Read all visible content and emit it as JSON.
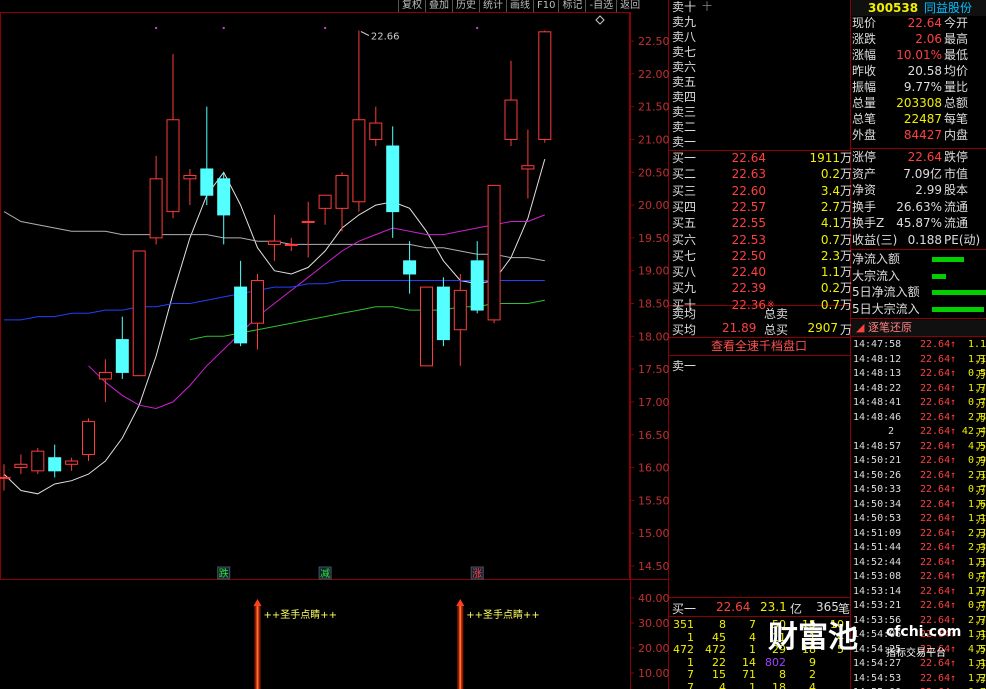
{
  "toolbar": {
    "items": [
      "复权",
      "叠加",
      "历史",
      "统计",
      "画线",
      "F10",
      "标记",
      "-自选",
      "返回"
    ]
  },
  "chart_data": {
    "type": "candlestick",
    "yaxis": {
      "ticks": [
        "22.50",
        "22.00",
        "21.50",
        "21.00",
        "20.50",
        "20.00",
        "19.50",
        "19.00",
        "18.50",
        "18.00",
        "17.50",
        "17.00",
        "16.50",
        "16.00",
        "15.50",
        "15.00",
        "14.50"
      ],
      "min": 14.5,
      "max": 22.5
    },
    "max_label": "22.66",
    "candles": [
      {
        "o": 15.85,
        "c": 15.85,
        "h": 16.05,
        "l": 15.65
      },
      {
        "o": 16.0,
        "c": 16.05,
        "h": 16.2,
        "l": 15.9
      },
      {
        "o": 15.95,
        "c": 16.25,
        "h": 16.3,
        "l": 15.9
      },
      {
        "o": 16.15,
        "c": 15.95,
        "h": 16.35,
        "l": 15.85
      },
      {
        "o": 16.05,
        "c": 16.1,
        "h": 16.15,
        "l": 15.95
      },
      {
        "o": 16.2,
        "c": 16.7,
        "h": 16.75,
        "l": 16.1
      },
      {
        "o": 17.35,
        "c": 17.45,
        "h": 17.65,
        "l": 17.0
      },
      {
        "o": 17.95,
        "c": 17.45,
        "h": 18.3,
        "l": 17.35
      },
      {
        "o": 17.4,
        "c": 19.3,
        "h": 19.3,
        "l": 17.4
      },
      {
        "o": 19.5,
        "c": 20.4,
        "h": 20.75,
        "l": 19.4
      },
      {
        "o": 19.9,
        "c": 21.3,
        "h": 22.3,
        "l": 19.8
      },
      {
        "o": 20.4,
        "c": 20.45,
        "h": 20.55,
        "l": 20.0
      },
      {
        "o": 20.55,
        "c": 20.15,
        "h": 21.5,
        "l": 20.0
      },
      {
        "o": 20.4,
        "c": 19.85,
        "h": 20.5,
        "l": 19.4
      },
      {
        "o": 18.75,
        "c": 17.9,
        "h": 19.15,
        "l": 17.85
      },
      {
        "o": 18.2,
        "c": 18.85,
        "h": 18.95,
        "l": 17.8
      },
      {
        "o": 19.4,
        "c": 19.45,
        "h": 19.85,
        "l": 19.15
      },
      {
        "o": 19.4,
        "c": 19.4,
        "h": 19.5,
        "l": 19.3
      },
      {
        "o": 19.75,
        "c": 19.75,
        "h": 20.05,
        "l": 19.2
      },
      {
        "o": 19.95,
        "c": 20.15,
        "h": 20.15,
        "l": 19.7
      },
      {
        "o": 19.95,
        "c": 20.45,
        "h": 20.5,
        "l": 19.6
      },
      {
        "o": 20.05,
        "c": 21.3,
        "h": 22.66,
        "l": 19.9
      },
      {
        "o": 21.0,
        "c": 21.25,
        "h": 21.5,
        "l": 20.9
      },
      {
        "o": 20.9,
        "c": 19.9,
        "h": 21.2,
        "l": 19.5
      },
      {
        "o": 19.15,
        "c": 18.95,
        "h": 19.45,
        "l": 18.65
      },
      {
        "o": 17.55,
        "c": 18.75,
        "h": 18.75,
        "l": 17.55
      },
      {
        "o": 18.75,
        "c": 17.95,
        "h": 18.9,
        "l": 17.85
      },
      {
        "o": 18.1,
        "c": 18.7,
        "h": 18.95,
        "l": 17.55
      },
      {
        "o": 19.15,
        "c": 18.4,
        "h": 19.45,
        "l": 18.35
      },
      {
        "o": 18.25,
        "c": 20.3,
        "h": 20.3,
        "l": 18.2
      },
      {
        "o": 21.0,
        "c": 21.6,
        "h": 22.2,
        "l": 20.9
      },
      {
        "o": 20.55,
        "c": 20.6,
        "h": 21.15,
        "l": 20.1
      },
      {
        "o": 21.0,
        "c": 22.64,
        "h": 22.66,
        "l": 20.95
      }
    ],
    "ma": {
      "white": [
        15.9,
        15.65,
        15.6,
        15.75,
        15.8,
        15.9,
        16.1,
        16.45,
        16.95,
        17.7,
        18.65,
        19.5,
        20.15,
        20.5,
        20.0,
        19.35,
        19.0,
        18.95,
        19.05,
        19.3,
        19.65,
        19.85,
        20.0,
        20.05,
        19.95,
        19.6,
        19.15,
        18.85,
        18.8,
        18.85,
        19.2,
        19.8,
        20.7
      ],
      "gray": [
        19.9,
        19.75,
        19.7,
        19.65,
        19.6,
        19.6,
        19.6,
        19.55,
        19.55,
        19.55,
        19.55,
        19.55,
        19.55,
        19.5,
        19.5,
        19.45,
        19.45,
        19.4,
        19.4,
        19.4,
        19.4,
        19.4,
        19.4,
        19.4,
        19.4,
        19.35,
        19.35,
        19.3,
        19.25,
        19.25,
        19.2,
        19.2,
        19.15
      ],
      "magenta": [
        null,
        null,
        null,
        null,
        null,
        17.55,
        17.3,
        17.1,
        16.95,
        16.9,
        17.0,
        17.25,
        17.55,
        17.8,
        18.05,
        18.3,
        18.5,
        18.7,
        18.9,
        19.1,
        19.3,
        19.45,
        19.55,
        19.65,
        19.6,
        19.55,
        19.55,
        19.6,
        19.65,
        19.7,
        19.75,
        19.75,
        19.85
      ],
      "blue": [
        18.25,
        18.25,
        18.3,
        18.3,
        18.35,
        18.35,
        18.4,
        18.4,
        18.45,
        18.45,
        18.5,
        18.5,
        18.55,
        18.6,
        18.65,
        18.7,
        18.75,
        18.75,
        18.8,
        18.8,
        18.85,
        18.85,
        18.85,
        18.85,
        18.85,
        18.85,
        18.85,
        18.85,
        18.85,
        18.85,
        18.85,
        18.85,
        18.85
      ],
      "green": [
        null,
        null,
        null,
        null,
        null,
        null,
        null,
        null,
        null,
        null,
        null,
        17.95,
        18.0,
        18.0,
        18.05,
        18.1,
        18.15,
        18.2,
        18.25,
        18.3,
        18.35,
        18.4,
        18.45,
        18.45,
        18.4,
        18.4,
        18.4,
        18.45,
        18.45,
        18.5,
        18.5,
        18.5,
        18.55
      ]
    },
    "markers": [
      {
        "i": 13,
        "text": "跌",
        "color": "#30e030"
      },
      {
        "i": 19,
        "text": "减",
        "color": "#30e030"
      },
      {
        "i": 28,
        "text": "涨",
        "color": "#ff4040"
      }
    ],
    "indicator": {
      "ticks": [
        "40.00",
        "30.00",
        "20.00",
        "10.00"
      ],
      "signals": [
        {
          "i": 15,
          "text": "++圣手点睛++"
        },
        {
          "i": 27,
          "text": "++圣手点睛++"
        }
      ]
    }
  },
  "stock": {
    "code": "300538",
    "name": "同益股份"
  },
  "info": [
    {
      "l": "现价",
      "v": "22.64",
      "vc": "#ff4040",
      "r": "今开"
    },
    {
      "l": "涨跌",
      "v": "2.06",
      "vc": "#ff4040",
      "r": "最高"
    },
    {
      "l": "涨幅",
      "v": "10.01%",
      "vc": "#ff4040",
      "r": "最低"
    },
    {
      "l": "昨收",
      "v": "20.58",
      "vc": "#dddddd",
      "r": "均价"
    },
    {
      "l": "振幅",
      "v": "9.77%",
      "vc": "#dddddd",
      "r": "量比"
    },
    {
      "l": "总量",
      "v": "203308",
      "vc": "#f0f000",
      "r": "总额"
    },
    {
      "l": "总笔",
      "v": "22487",
      "vc": "#f0f000",
      "r": "每笔"
    },
    {
      "l": "外盘",
      "v": "84427",
      "vc": "#ff4040",
      "r": "内盘"
    },
    {
      "l": "涨停",
      "v": "22.64",
      "vc": "#ff4040",
      "r": "跌停"
    },
    {
      "l": "资产",
      "v": "7.09亿",
      "vc": "#dddddd",
      "r": "市值"
    },
    {
      "l": "净资",
      "v": "2.99",
      "vc": "#dddddd",
      "r": "股本"
    },
    {
      "l": "换手",
      "v": "26.63%",
      "vc": "#dddddd",
      "r": "流通"
    },
    {
      "l": "换手Z",
      "v": "45.87%",
      "vc": "#dddddd",
      "r": "流通"
    },
    {
      "l": "收益(三)",
      "v": "0.188",
      "vc": "#dddddd",
      "r": "PE(动)"
    }
  ],
  "flows": [
    {
      "label": "净流入额",
      "w": 32
    },
    {
      "label": "大宗流入",
      "w": 14
    },
    {
      "label": "5日净流入额",
      "w": 56
    },
    {
      "label": "5日大宗流入",
      "w": 52
    }
  ],
  "ticks_title": "逐笔还原",
  "ticks": [
    {
      "t": "14:47:58",
      "p": "22.64",
      "v": "1.1万",
      "n": ""
    },
    {
      "t": "14:48:12",
      "p": "22.64",
      "v": "1.1万",
      "n": ""
    },
    {
      "t": "14:48:13",
      "p": "22.64",
      "v": "0.5万",
      "n": ""
    },
    {
      "t": "14:48:22",
      "p": "22.64",
      "v": "1.7万",
      "n": ""
    },
    {
      "t": "14:48:41",
      "p": "22.64",
      "v": "0.7万",
      "n": ""
    },
    {
      "t": "14:48:46",
      "p": "22.64",
      "v": "2.8万",
      "n": ""
    },
    {
      "t": "",
      "p": "22.64",
      "v": "42.4万",
      "n": "2"
    },
    {
      "t": "14:48:57",
      "p": "22.64",
      "v": "4.5万",
      "n": ""
    },
    {
      "t": "14:50:21",
      "p": "22.64",
      "v": "0.9万",
      "n": ""
    },
    {
      "t": "14:50:26",
      "p": "22.64",
      "v": "2.1万",
      "n": ""
    },
    {
      "t": "14:50:33",
      "p": "22.64",
      "v": "0.7万",
      "n": ""
    },
    {
      "t": "14:50:34",
      "p": "22.64",
      "v": "1.6万",
      "n": ""
    },
    {
      "t": "14:50:53",
      "p": "22.64",
      "v": "1.1万",
      "n": ""
    },
    {
      "t": "14:51:09",
      "p": "22.64",
      "v": "2.3万",
      "n": ""
    },
    {
      "t": "14:51:44",
      "p": "22.64",
      "v": "2.3万",
      "n": ""
    },
    {
      "t": "14:52:44",
      "p": "22.64",
      "v": "1.1万",
      "n": ""
    },
    {
      "t": "14:53:08",
      "p": "22.64",
      "v": "0.7万",
      "n": ""
    },
    {
      "t": "14:53:14",
      "p": "22.64",
      "v": "1.7万",
      "n": ""
    },
    {
      "t": "14:53:21",
      "p": "22.64",
      "v": "0.7万",
      "n": ""
    },
    {
      "t": "14:53:56",
      "p": "22.64",
      "v": "2.7万",
      "n": ""
    },
    {
      "t": "14:54:06",
      "p": "22.64",
      "v": "1.1万",
      "n": ""
    },
    {
      "t": "14:54:25",
      "p": "22.64",
      "v": "4.5万",
      "n": ""
    },
    {
      "t": "14:54:27",
      "p": "22.64",
      "v": "1.1万",
      "n": ""
    },
    {
      "t": "14:54:53",
      "p": "22.64",
      "v": "1.2万",
      "n": ""
    },
    {
      "t": "14:55:00",
      "p": "22.64",
      "v": "0.7万",
      "n": ""
    }
  ],
  "sells": [
    "卖十",
    "卖九",
    "卖八",
    "卖七",
    "卖六",
    "卖五",
    "卖四",
    "卖三",
    "卖二",
    "卖一"
  ],
  "sells_extra": "十",
  "buys": [
    {
      "l": "买一",
      "p": "22.64",
      "v": "1911",
      "u": "万"
    },
    {
      "l": "买二",
      "p": "22.63",
      "v": "0.2",
      "u": "万"
    },
    {
      "l": "买三",
      "p": "22.60",
      "v": "3.4",
      "u": "万"
    },
    {
      "l": "买四",
      "p": "22.57",
      "v": "2.7",
      "u": "万"
    },
    {
      "l": "买五",
      "p": "22.55",
      "v": "4.1",
      "u": "万"
    },
    {
      "l": "买六",
      "p": "22.53",
      "v": "0.7",
      "u": "万"
    },
    {
      "l": "买七",
      "p": "22.50",
      "v": "2.3",
      "u": "万"
    },
    {
      "l": "买八",
      "p": "22.40",
      "v": "1.1",
      "u": "万"
    },
    {
      "l": "买九",
      "p": "22.39",
      "v": "0.2",
      "u": "万"
    },
    {
      "l": "买十",
      "p": "22.36",
      "v": "0.7",
      "u": "万",
      "mark": "※"
    }
  ],
  "avg": {
    "sell_avg": "卖均",
    "total_sell": "总卖",
    "buy_avg": "买均",
    "buy_avg_val": "21.89",
    "total_buy": "总买",
    "total_buy_val": "2907",
    "total_buy_unit": "万"
  },
  "view_btn": "查看全速千档盘口",
  "sell_one_lbl": "卖一",
  "buy_one_bar": {
    "l": "买一",
    "p": "22.64",
    "v": "23.1",
    "u": "亿",
    "cnt": "365",
    "unit": "笔"
  },
  "queue": [
    [
      "351",
      "8",
      "7",
      "50",
      "15",
      "10"
    ],
    [
      "1",
      "45",
      "4",
      "11",
      "1",
      "4"
    ],
    [
      "472",
      "472",
      "1",
      "29",
      "18",
      "5"
    ],
    [
      "1",
      "22",
      "14",
      "802",
      "9",
      ""
    ],
    [
      "7",
      "15",
      "71",
      "8",
      "2",
      ""
    ],
    [
      "7",
      "4",
      "1",
      "18",
      "4",
      ""
    ]
  ],
  "watermark": {
    "brand": "财富池",
    "url": "cfchi.com",
    "sub": "指标交易平台"
  }
}
